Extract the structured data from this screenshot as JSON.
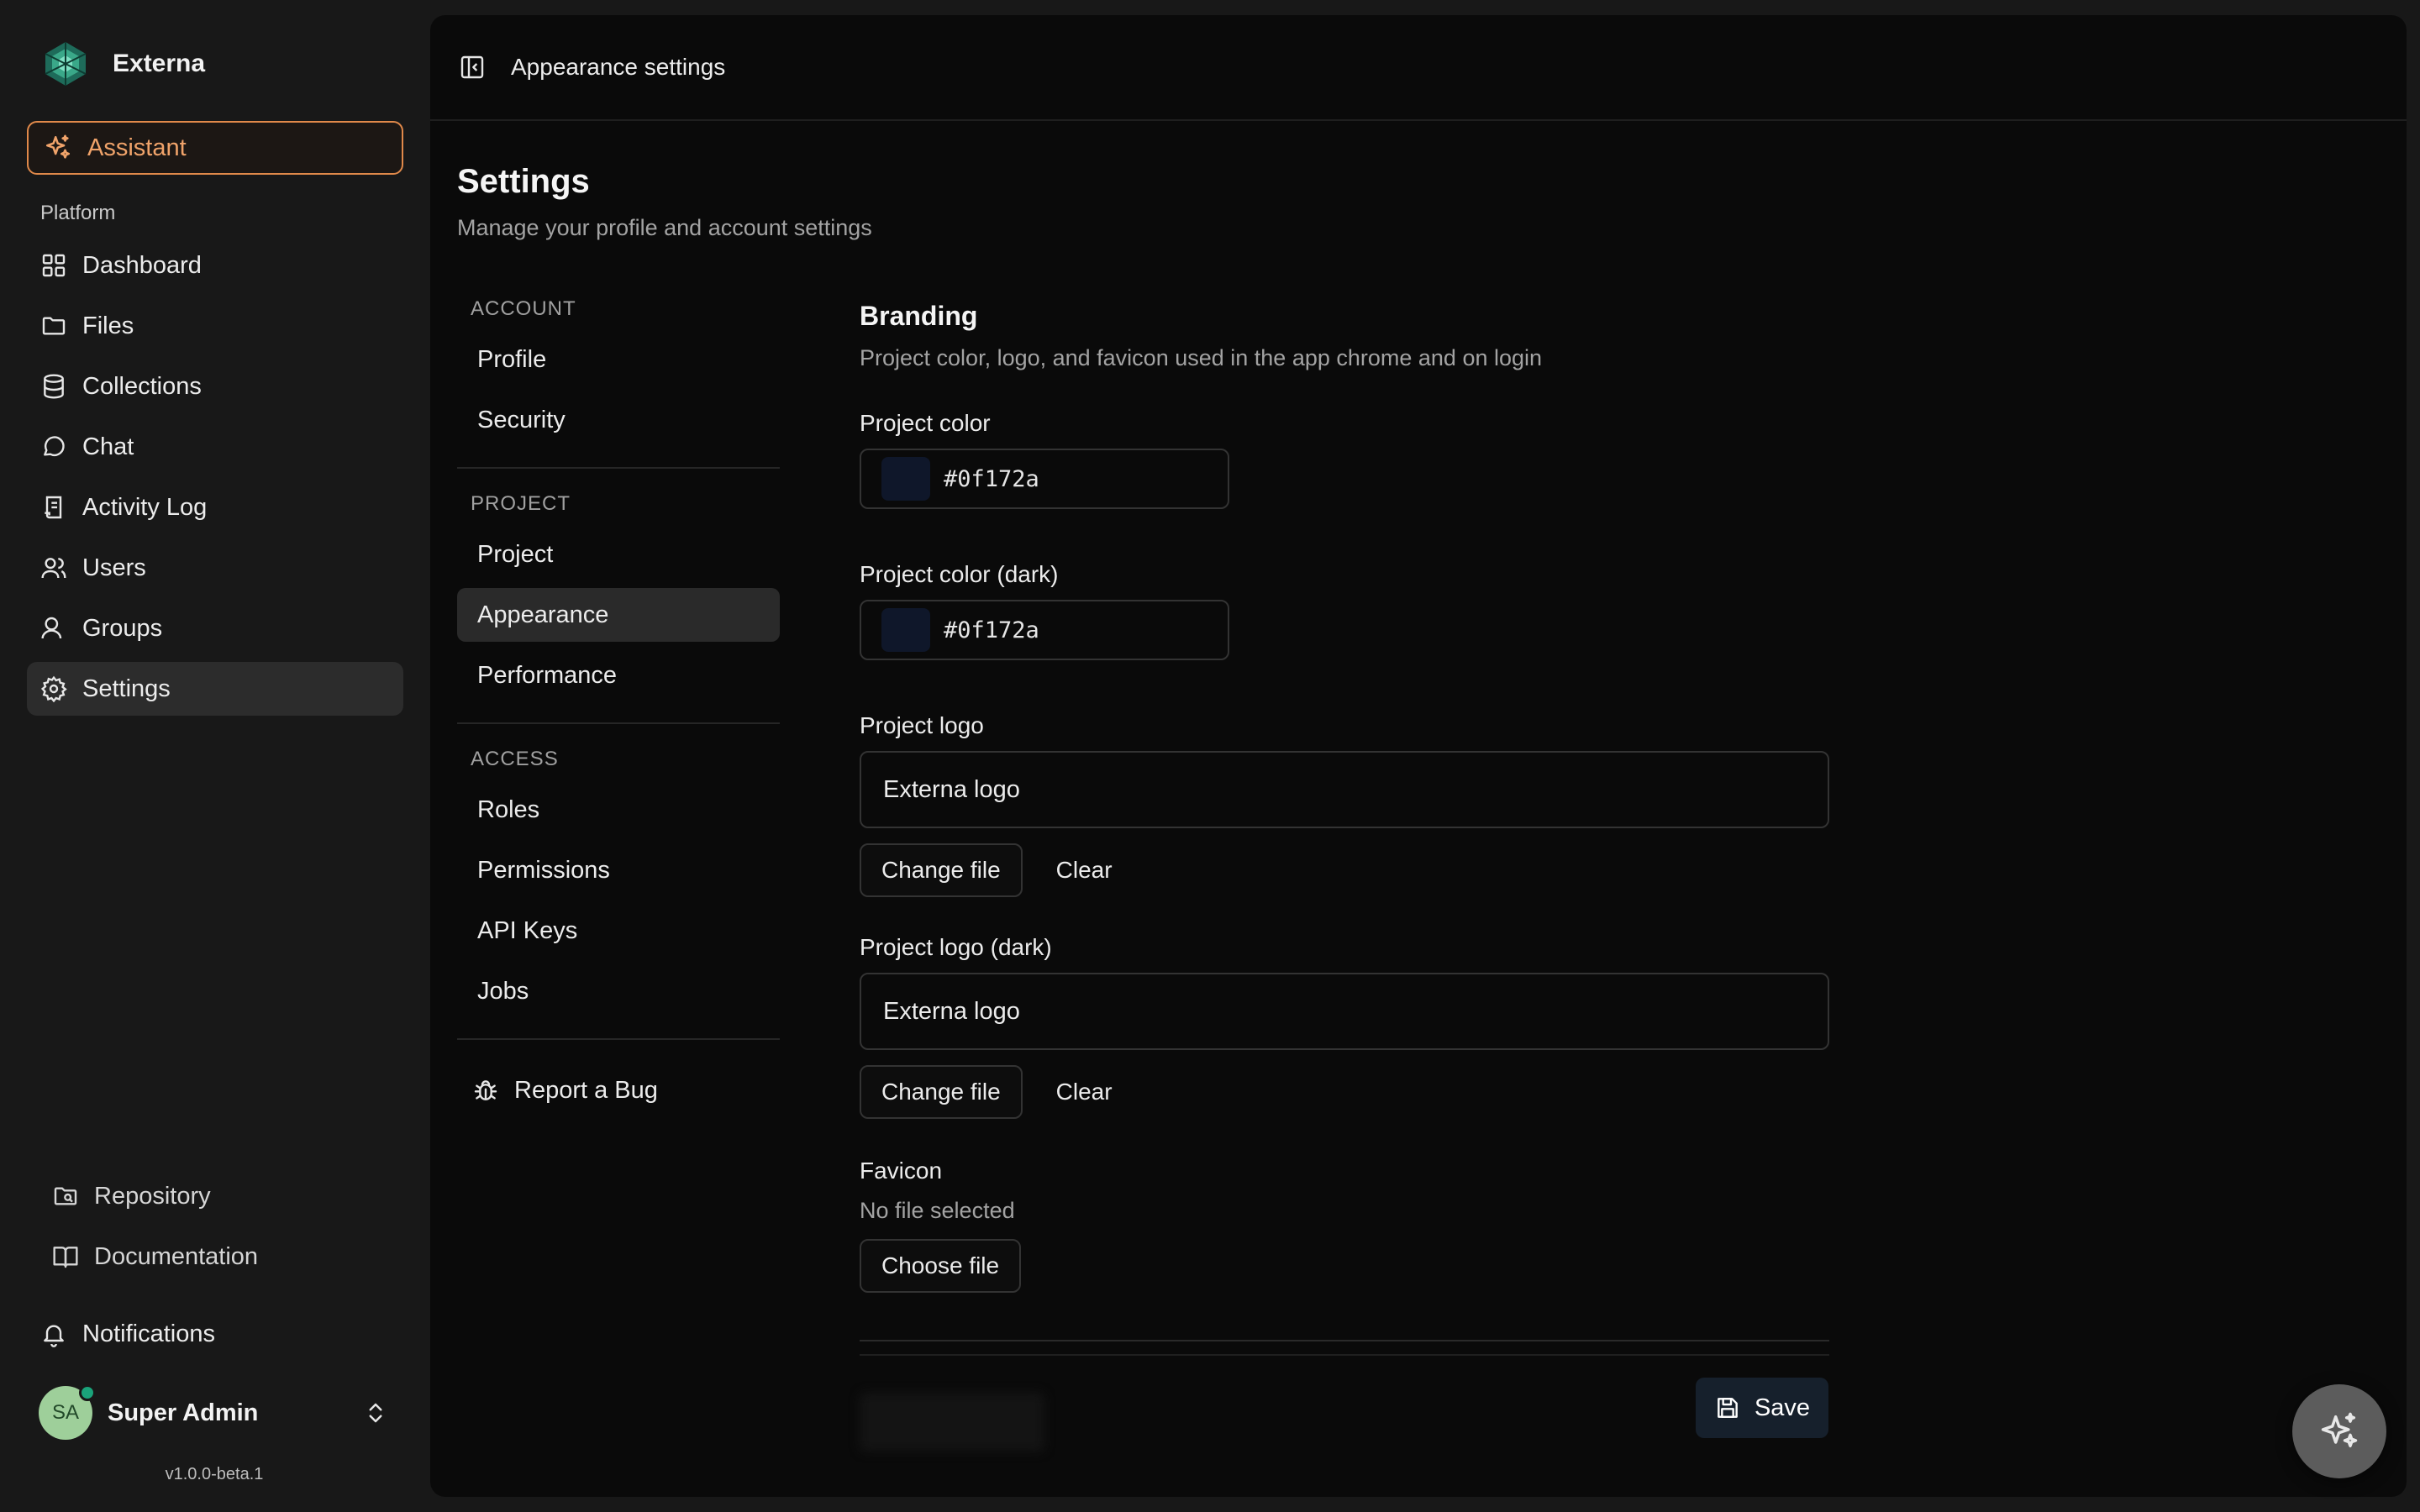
{
  "brand": {
    "name": "Externa",
    "logo_icon": "externa-logo"
  },
  "assistant": {
    "label": "Assistant",
    "icon": "sparkles-icon",
    "accent": "#e0894a"
  },
  "sidebar": {
    "group_label": "Platform",
    "items": [
      {
        "label": "Dashboard",
        "icon": "grid-icon"
      },
      {
        "label": "Files",
        "icon": "folder-icon"
      },
      {
        "label": "Collections",
        "icon": "database-icon"
      },
      {
        "label": "Chat",
        "icon": "chat-bubble-icon"
      },
      {
        "label": "Activity Log",
        "icon": "log-icon"
      },
      {
        "label": "Users",
        "icon": "users-icon"
      },
      {
        "label": "Groups",
        "icon": "group-icon"
      },
      {
        "label": "Settings",
        "icon": "gear-icon",
        "active": true
      }
    ],
    "bottom_links": [
      {
        "label": "Repository",
        "icon": "repo-icon"
      },
      {
        "label": "Documentation",
        "icon": "book-icon"
      }
    ],
    "notifications": "Notifications",
    "user": {
      "initials": "SA",
      "name": "Super Admin"
    },
    "version": "v1.0.0-beta.1"
  },
  "topbar": {
    "title": "Appearance settings"
  },
  "page": {
    "title": "Settings",
    "subtitle": "Manage your profile and account settings"
  },
  "settings_nav": {
    "account_label": "ACCOUNT",
    "account_items": [
      "Profile",
      "Security"
    ],
    "project_label": "PROJECT",
    "project_items": [
      "Project",
      "Appearance",
      "Performance"
    ],
    "access_label": "ACCESS",
    "access_items": [
      "Roles",
      "Permissions",
      "API Keys",
      "Jobs"
    ],
    "report_bug": "Report a Bug",
    "active": "Appearance"
  },
  "branding": {
    "title": "Branding",
    "description": "Project color, logo, and favicon used in the app chrome and on login",
    "project_color": {
      "label": "Project color",
      "value": "#0f172a"
    },
    "project_color_dark": {
      "label": "Project color (dark)",
      "value": "#0f172a"
    },
    "project_logo": {
      "label": "Project logo",
      "file": "Externa logo",
      "change": "Change file",
      "clear": "Clear"
    },
    "project_logo_dark": {
      "label": "Project logo (dark)",
      "file": "Externa logo",
      "change": "Change file",
      "clear": "Clear"
    },
    "favicon": {
      "label": "Favicon",
      "status": "No file selected",
      "choose": "Choose file"
    }
  },
  "actions": {
    "save": "Save"
  }
}
